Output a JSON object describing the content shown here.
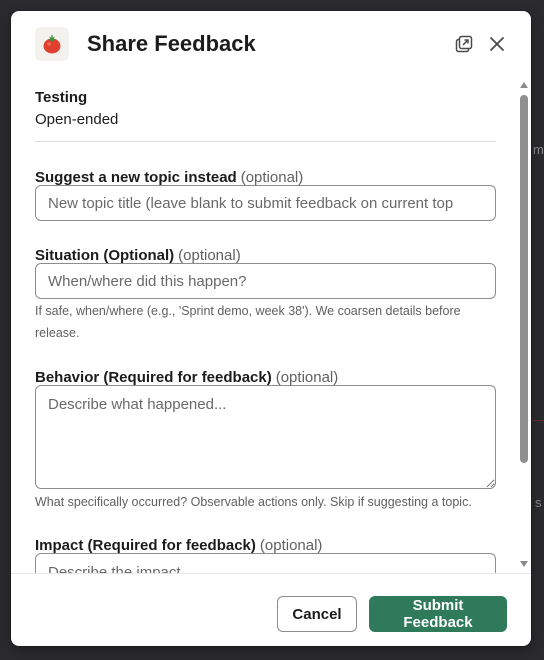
{
  "modal": {
    "title": "Share Feedback",
    "app_icon": "tomato-icon",
    "header_icons": [
      "popout-icon",
      "close-icon"
    ]
  },
  "context": {
    "label": "Testing",
    "value": "Open-ended"
  },
  "fields": {
    "topic": {
      "label": "Suggest a new topic instead",
      "optional": "(optional)",
      "placeholder": "New topic title (leave blank to submit feedback on current top"
    },
    "situation": {
      "label": "Situation (Optional)",
      "optional": "(optional)",
      "placeholder": "When/where did this happen?",
      "hint": "If safe, when/where (e.g., 'Sprint demo, week 38'). We coarsen details before release."
    },
    "behavior": {
      "label": "Behavior (Required for feedback)",
      "optional": "(optional)",
      "placeholder": "Describe what happened...",
      "hint": "What specifically occurred? Observable actions only. Skip if suggesting a topic."
    },
    "impact": {
      "label": "Impact (Required for feedback)",
      "optional": "(optional)",
      "placeholder": "Describe the impact..."
    }
  },
  "footer": {
    "cancel_label": "Cancel",
    "submit_label": "Submit Feedback"
  },
  "background": {
    "glyphs": [
      "m",
      "s"
    ]
  },
  "colors": {
    "primary_button": "#2f7a5a",
    "text": "#1d1c1d",
    "muted_text": "#616061",
    "backdrop": "#2b2b2e"
  }
}
